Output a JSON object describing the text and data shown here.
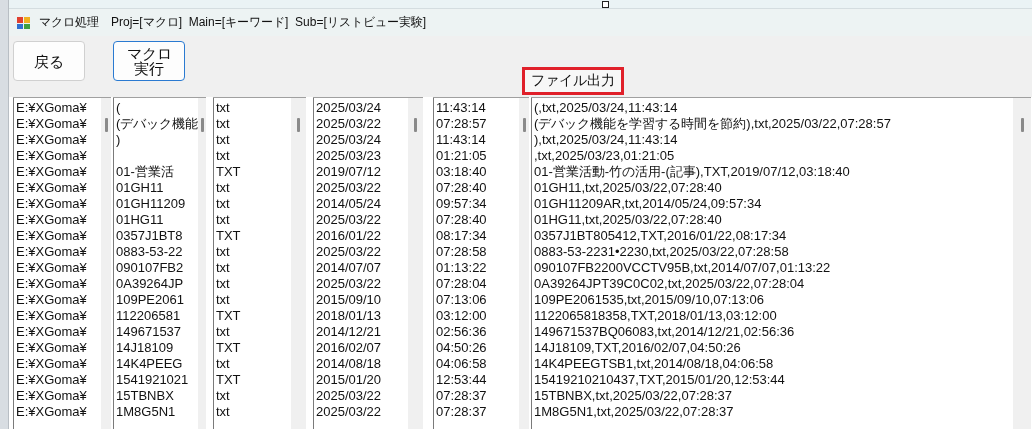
{
  "window": {
    "title": "マクロ処理　Proj=[マクロ]  Main=[キーワード]  Sub=[リストビュー実験]"
  },
  "buttons": [
    {
      "label": "戻る",
      "focused": false
    },
    {
      "label": "マクロ実行",
      "focused": true
    }
  ],
  "file_output_button": {
    "label": "ファイル出力",
    "highlighted": true
  },
  "rows": [
    {
      "path": "E:¥XGoma¥",
      "name": "(",
      "ext": "txt",
      "date": "2025/03/24",
      "time": "11:43:14"
    },
    {
      "path": "E:¥XGoma¥",
      "name": "(デバック機能",
      "ext": "txt",
      "date": "2025/03/22",
      "time": "07:28:57"
    },
    {
      "path": "E:¥XGoma¥",
      "name": ")",
      "ext": "txt",
      "date": "2025/03/24",
      "time": "11:43:14"
    },
    {
      "path": "E:¥XGoma¥",
      "ext": "txt",
      "date": "2025/03/23",
      "time": "01:21:05"
    },
    {
      "path": "E:¥XGoma¥",
      "name": "01-営業活",
      "ext": "TXT",
      "date": "2019/07/12",
      "time": "03:18:40"
    },
    {
      "path": "E:¥XGoma¥",
      "name": "01GH11",
      "ext": "txt",
      "date": "2025/03/22",
      "time": "07:28:40"
    },
    {
      "path": "E:¥XGoma¥",
      "name": "01GH11209",
      "ext": "txt",
      "date": "2014/05/24",
      "time": "09:57:34"
    },
    {
      "path": "E:¥XGoma¥",
      "name": "01HG11",
      "ext": "txt",
      "date": "2025/03/22",
      "time": "07:28:40"
    },
    {
      "path": "E:¥XGoma¥",
      "name": "0357J1BT8",
      "ext": "TXT",
      "date": "2016/01/22",
      "time": "08:17:34"
    },
    {
      "path": "E:¥XGoma¥",
      "name": "0883-53-22",
      "ext": "txt",
      "date": "2025/03/22",
      "time": "07:28:58"
    },
    {
      "path": "E:¥XGoma¥",
      "name": "090107FB2",
      "ext": "txt",
      "date": "2014/07/07",
      "time": "01:13:22"
    },
    {
      "path": "E:¥XGoma¥",
      "name": "0A39264JP",
      "ext": "txt",
      "date": "2025/03/22",
      "time": "07:28:04"
    },
    {
      "path": "E:¥XGoma¥",
      "name": "109PE2061",
      "ext": "txt",
      "date": "2015/09/10",
      "time": "07:13:06"
    },
    {
      "path": "E:¥XGoma¥",
      "name": "112206581",
      "ext": "TXT",
      "date": "2018/01/13",
      "time": "03:12:00"
    },
    {
      "path": "E:¥XGoma¥",
      "name": "149671537",
      "ext": "txt",
      "date": "2014/12/21",
      "time": "02:56:36"
    },
    {
      "path": "E:¥XGoma¥",
      "name": "14J18109",
      "ext": "TXT",
      "date": "2016/02/07",
      "time": "04:50:26"
    },
    {
      "path": "E:¥XGoma¥",
      "name": "14K4PEEG",
      "ext": "txt",
      "date": "2014/08/18",
      "time": "04:06:58"
    },
    {
      "path": "E:¥XGoma¥",
      "name": "1541921021",
      "ext": "TXT",
      "date": "2015/01/20",
      "time": "12:53:44"
    },
    {
      "path": "E:¥XGoma¥",
      "name": "15TBNBX",
      "ext": "txt",
      "date": "2025/03/22",
      "time": "07:28:37"
    },
    {
      "path": "E:¥XGoma¥",
      "name": "1M8G5N1",
      "ext": "txt",
      "date": "2025/03/22",
      "time": "07:28:37"
    }
  ],
  "output_lines": [
    "(,txt,2025/03/24,11:43:14",
    "(デバック機能を学習する時間を節約),txt,2025/03/22,07:28:57",
    "),txt,2025/03/24,11:43:14",
    ",txt,2025/03/23,01:21:05",
    "01-営業活動-竹の活用-(記事),TXT,2019/07/12,03:18:40",
    "01GH11,txt,2025/03/22,07:28:40",
    "01GH11209AR,txt,2014/05/24,09:57:34",
    "01HG11,txt,2025/03/22,07:28:40",
    "0357J1BT805412,TXT,2016/01/22,08:17:34",
    "0883-53-2231•2230,txt,2025/03/22,07:28:58",
    "090107FB2200VCCTV95B,txt,2014/07/07,01:13:22",
    "0A39264JPT39C0C02,txt,2025/03/22,07:28:04",
    "109PE2061535,txt,2015/09/10,07:13:06",
    "1122065818358,TXT,2018/01/13,03:12:00",
    "149671537BQ06083,txt,2014/12/21,02:56:36",
    "14J18109,TXT,2016/02/07,04:50:26",
    "14K4PEEGTSB1,txt,2014/08/18,04:06:58",
    "15419210210437,TXT,2015/01/20,12:53:44",
    "15TBNBX,txt,2025/03/22,07:28:37",
    "1M8G5N1,txt,2025/03/22,07:28:37"
  ]
}
